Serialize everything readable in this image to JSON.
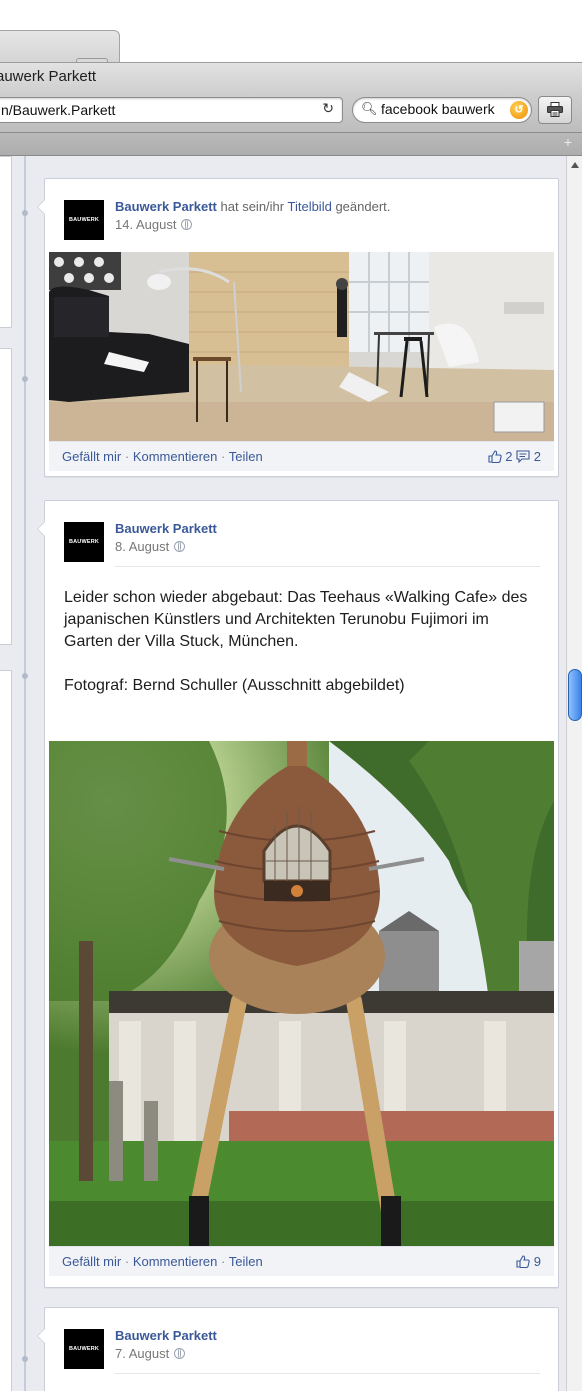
{
  "browser": {
    "window_title": "auwerk Parkett",
    "url": "n/Bauwerk.Parkett",
    "search_value": "facebook bauwerk"
  },
  "posts": [
    {
      "author": "Bauwerk Parkett",
      "action": "hat sein/ihr",
      "action_link": "Titelbild",
      "action_suffix": "geändert.",
      "date": "14. August",
      "avatar_text": "BAUWERK",
      "footer": {
        "like": "Gefällt mir",
        "comment": "Kommentieren",
        "share": "Teilen"
      },
      "likes": "2",
      "comments": "2"
    },
    {
      "author": "Bauwerk Parkett",
      "date": "8. August",
      "avatar_text": "BAUWERK",
      "text_para1_line1": "Leider schon wieder abgebaut: Das Teehaus «Walking Cafe» des",
      "text_para1_line2": "japanischen Künstlers und Architekten Terunobu Fujimori im Garten der Villa Stuck, München.",
      "text_para2": "Fotograf: Bernd Schuller (Ausschnitt abgebildet)",
      "footer": {
        "like": "Gefällt mir",
        "comment": "Kommentieren",
        "share": "Teilen"
      },
      "likes": "9"
    },
    {
      "author": "Bauwerk Parkett",
      "date": "7. August",
      "avatar_text": "BAUWERK"
    }
  ],
  "colors": {
    "facebook_blue": "#3b5998",
    "page_bg": "#e9ebf0"
  },
  "icons": [
    "reload-icon",
    "search-icon",
    "print-icon",
    "globe-icon",
    "like-icon",
    "comment-icon"
  ]
}
